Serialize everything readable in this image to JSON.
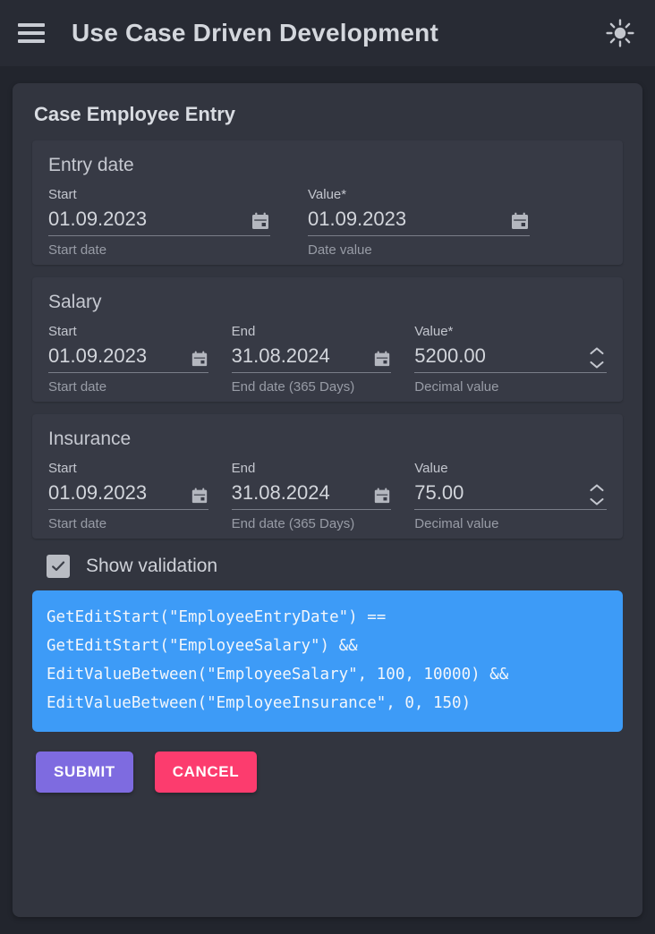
{
  "appbar": {
    "menu_icon": "hamburger-menu-icon",
    "title": "Use Case Driven Development",
    "theme_icon": "sun-icon"
  },
  "card": {
    "title": "Case Employee Entry"
  },
  "sections": [
    {
      "title": "Entry date",
      "fields": [
        {
          "label": "Start",
          "value": "01.09.2023",
          "hint": "Start date",
          "icon": "calendar-icon"
        },
        {
          "label": "Value*",
          "value": "01.09.2023",
          "hint": "Date value",
          "icon": "calendar-icon"
        }
      ]
    },
    {
      "title": "Salary",
      "fields": [
        {
          "label": "Start",
          "value": "01.09.2023",
          "hint": "Start date",
          "icon": "calendar-icon"
        },
        {
          "label": "End",
          "value": "31.08.2024",
          "hint": "End date (365 Days)",
          "icon": "calendar-icon"
        },
        {
          "label": "Value*",
          "value": "5200.00",
          "hint": "Decimal value",
          "icon": "stepper-icon"
        }
      ]
    },
    {
      "title": "Insurance",
      "fields": [
        {
          "label": "Start",
          "value": "01.09.2023",
          "hint": "Start date",
          "icon": "calendar-icon"
        },
        {
          "label": "End",
          "value": "31.08.2024",
          "hint": "End date (365 Days)",
          "icon": "calendar-icon"
        },
        {
          "label": "Value",
          "value": "75.00",
          "hint": "Decimal value",
          "icon": "stepper-icon"
        }
      ]
    }
  ],
  "validation": {
    "checkbox_label": "Show validation",
    "checkbox_checked": true,
    "expression": "GetEditStart(\"EmployeeEntryDate\") == GetEditStart(\"EmployeeSalary\") && EditValueBetween(\"EmployeeSalary\", 100, 10000) && EditValueBetween(\"EmployeeInsurance\", 0, 150)"
  },
  "actions": {
    "submit_label": "SUBMIT",
    "cancel_label": "CANCEL"
  },
  "colors": {
    "page_background": "#22252d",
    "appbar_background": "#282b34",
    "card_background": "#32353f",
    "section_background": "#373a45",
    "validation_background": "#3d9bf7",
    "submit": "#7e6be0",
    "cancel": "#fc3c6e",
    "text_primary": "#d4d7dd",
    "text_secondary": "#989ca6"
  }
}
